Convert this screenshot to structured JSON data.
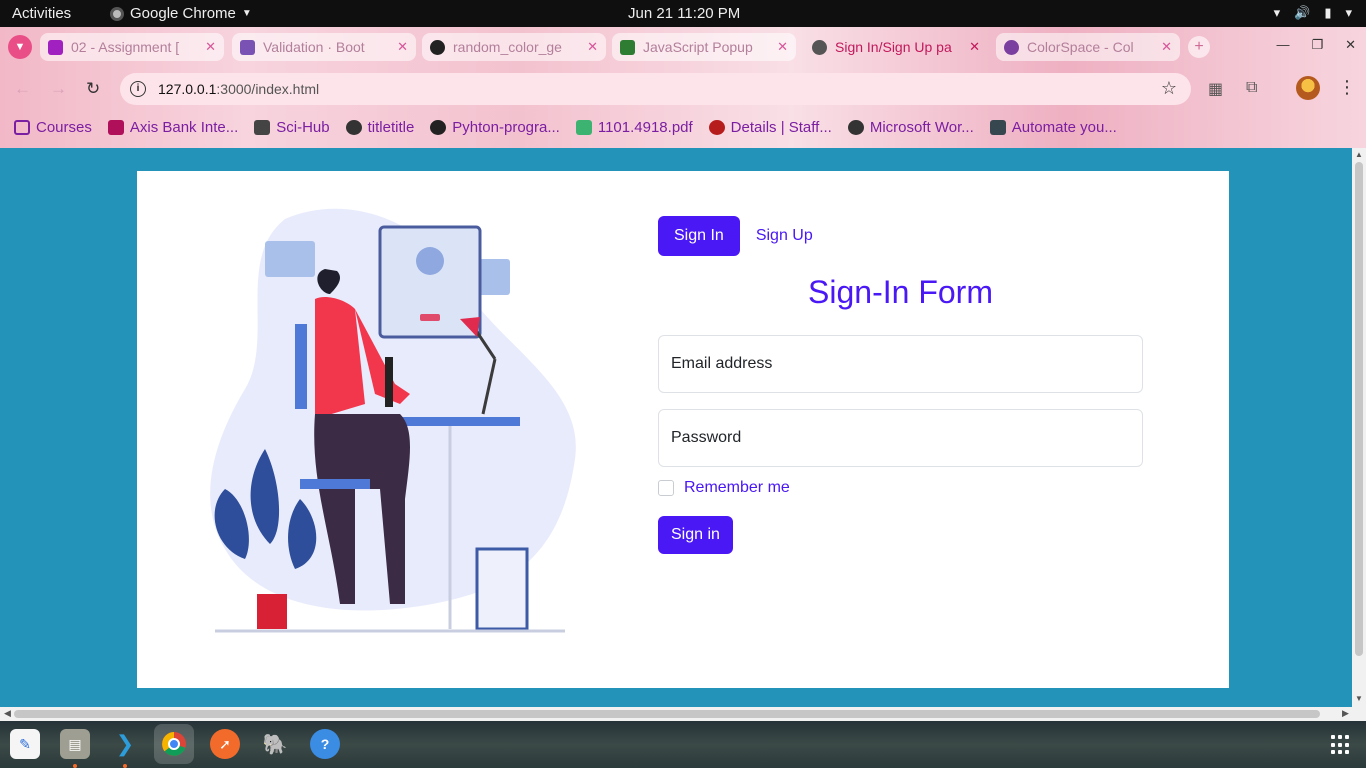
{
  "system_bar": {
    "activities": "Activities",
    "app_name": "Google Chrome",
    "datetime": "Jun 21  11:20 PM"
  },
  "browser": {
    "tabs": [
      {
        "label": "02 - Assignment [",
        "favicon_color": "#a020c0",
        "active": false
      },
      {
        "label": "Validation · Boot",
        "favicon_color": "#7952b3",
        "active": false
      },
      {
        "label": "random_color_ge",
        "favicon_color": "#222222",
        "active": false
      },
      {
        "label": "JavaScript Popup",
        "favicon_color": "#2e7d32",
        "active": false
      },
      {
        "label": "Sign In/Sign Up pa",
        "favicon_color": "#555555",
        "active": true
      },
      {
        "label": "ColorSpace - Col",
        "favicon_color": "#7b3fa0",
        "active": false
      }
    ],
    "url_host": "127.0.0.1",
    "url_path": ":3000/index.html",
    "bookmarks": [
      {
        "label": "Courses",
        "icon": "folder-icon",
        "color": "#7b1fa2"
      },
      {
        "label": "Axis Bank Inte...",
        "icon": "axis-icon",
        "color": "#b0105a"
      },
      {
        "label": "Sci-Hub",
        "icon": "scihub-icon",
        "color": "#444444"
      },
      {
        "label": "titletitle",
        "icon": "globe-icon",
        "color": "#333333"
      },
      {
        "label": "Pyhton-progra...",
        "icon": "github-icon",
        "color": "#222222"
      },
      {
        "label": "1101.4918.pdf",
        "icon": "pdf-icon",
        "color": "#3cb371"
      },
      {
        "label": "Details | Staff...",
        "icon": "staff-icon",
        "color": "#b71c1c"
      },
      {
        "label": "Microsoft Wor...",
        "icon": "globe-icon",
        "color": "#333333"
      },
      {
        "label": "Automate you...",
        "icon": "tds-icon",
        "color": "#37474f"
      }
    ]
  },
  "page": {
    "tab_signin": "Sign In",
    "tab_signup": "Sign Up",
    "form_title": "Sign-In Form",
    "email_label": "Email address",
    "password_label": "Password",
    "remember_label": "Remember me",
    "submit_label": "Sign in",
    "accent_color": "#4a18f5",
    "background_color": "#2393b9"
  },
  "dock": {
    "apps": [
      "text-editor-icon",
      "files-icon",
      "vscode-icon",
      "chrome-icon",
      "postman-icon",
      "postgres-icon",
      "help-icon",
      "app-grid-icon"
    ]
  }
}
